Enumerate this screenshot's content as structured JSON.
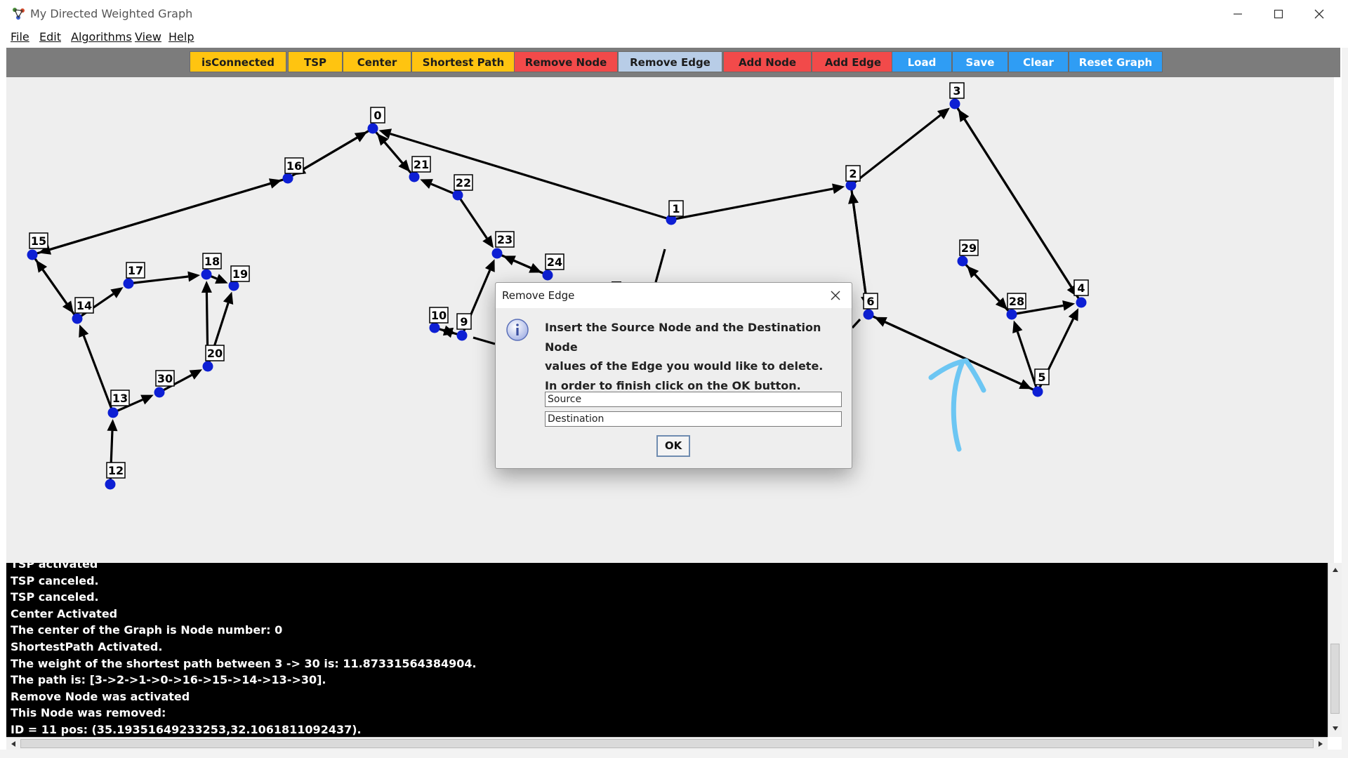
{
  "window": {
    "title": "My Directed Weighted Graph"
  },
  "menu": [
    {
      "label": "File"
    },
    {
      "label": "Edit"
    },
    {
      "label": "Algorithms"
    },
    {
      "label": "View"
    },
    {
      "label": "Help"
    }
  ],
  "toolbar": [
    {
      "label": "isConnected",
      "color": "#ffc410"
    },
    {
      "label": "TSP",
      "color": "#ffc410"
    },
    {
      "label": "Center",
      "color": "#ffc410"
    },
    {
      "label": "Shortest Path",
      "color": "#ffc410"
    },
    {
      "label": "Remove Node",
      "color": "#f24a4a"
    },
    {
      "label": "Remove Edge",
      "color": "#b8cde7"
    },
    {
      "label": "Add Node",
      "color": "#f24a4a"
    },
    {
      "label": "Add Edge",
      "color": "#f24a4a"
    },
    {
      "label": "Load",
      "color": "#2f9df4"
    },
    {
      "label": "Save",
      "color": "#2f9df4"
    },
    {
      "label": "Clear",
      "color": "#2f9df4"
    },
    {
      "label": "Reset Graph",
      "color": "#2f9df4"
    }
  ],
  "graph": {
    "node_color": "#0d1fd4",
    "edge_color": "#000000",
    "annotation_color": "#6cc6f3",
    "nodes": [
      "0",
      "1",
      "2",
      "3",
      "4",
      "5",
      "6",
      "9",
      "10",
      "12",
      "13",
      "14",
      "15",
      "16",
      "17",
      "18",
      "19",
      "20",
      "21",
      "22",
      "23",
      "24",
      "28",
      "29",
      "30"
    ]
  },
  "dialog": {
    "title": "Remove Edge",
    "message": [
      "Insert the Source Node and the Destination Node",
      "values of the Edge you would like to delete.",
      "In order to finish click on the OK button."
    ],
    "source_value": "Source",
    "destination_value": "Destination",
    "ok_label": "OK",
    "icon": "info-icon"
  },
  "console": [
    "TSP activated",
    "TSP canceled.",
    "TSP canceled.",
    "Center Activated",
    "The center of the Graph is Node number: 0",
    "ShortestPath Activated.",
    "The weight of the shortest path between 3 -> 30 is: 11.87331564384904.",
    "The path is: [3->2->1->0->16->15->14->13->30].",
    "Remove Node was activated",
    "This Node was removed:",
    "ID = 11 pos: (35.19351649233253,32.1061811092437)."
  ]
}
